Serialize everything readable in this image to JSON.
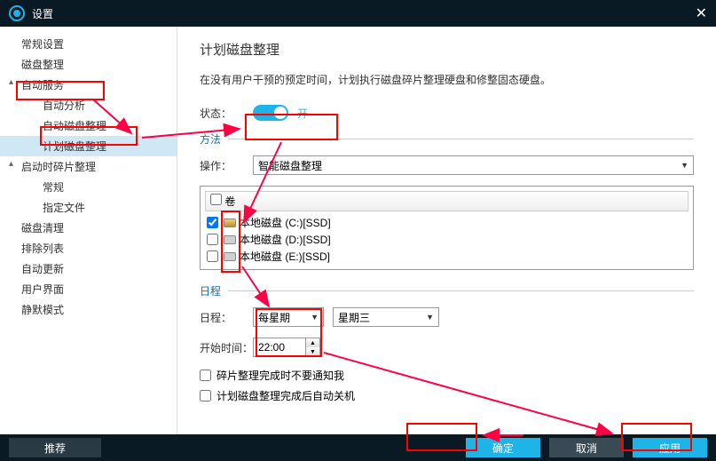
{
  "title": "设置",
  "sidebar": {
    "items": [
      {
        "label": "常规设置",
        "toggle": ""
      },
      {
        "label": "磁盘整理",
        "toggle": ""
      },
      {
        "label": "自动服务",
        "toggle": "▴"
      },
      {
        "label": "自动分析",
        "toggle": ""
      },
      {
        "label": "自动磁盘整理",
        "toggle": ""
      },
      {
        "label": "计划磁盘整理",
        "toggle": ""
      },
      {
        "label": "启动时碎片整理",
        "toggle": "▴"
      },
      {
        "label": "常规",
        "toggle": ""
      },
      {
        "label": "指定文件",
        "toggle": ""
      },
      {
        "label": "磁盘清理",
        "toggle": ""
      },
      {
        "label": "排除列表",
        "toggle": ""
      },
      {
        "label": "自动更新",
        "toggle": ""
      },
      {
        "label": "用户界面",
        "toggle": ""
      },
      {
        "label": "静默模式",
        "toggle": ""
      }
    ]
  },
  "content": {
    "heading": "计划磁盘整理",
    "description": "在没有用户干预的预定时间，计划执行磁盘碎片整理硬盘和修整固态硬盘。",
    "status_label": "状态：",
    "toggle_state": "开",
    "method_legend": "方法",
    "operation_label": "操作：",
    "operation_value": "智能磁盘整理",
    "volumes_header": "卷",
    "volumes": [
      {
        "name": "本地磁盘 (C:)[SSD]",
        "checked": true
      },
      {
        "name": "本地磁盘 (D:)[SSD]",
        "checked": false
      },
      {
        "name": "本地磁盘 (E:)[SSD]",
        "checked": false
      }
    ],
    "schedule_legend": "日程",
    "date_label": "日程：",
    "frequency": "每星期",
    "weekday": "星期三",
    "start_time_label": "开始时间：",
    "start_time": "22:00",
    "notify_label": "碎片整理完成时不要通知我",
    "shutdown_label": "计划磁盘整理完成后自动关机"
  },
  "footer": {
    "recommend": "推荐",
    "ok": "确定",
    "cancel": "取消",
    "apply": "应用"
  }
}
